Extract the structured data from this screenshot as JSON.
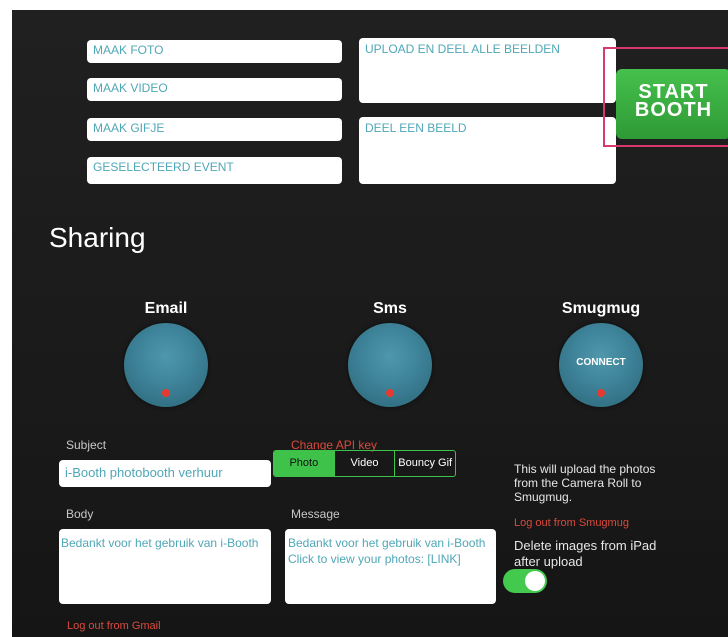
{
  "fields": {
    "maak_foto": "MAAK FOTO",
    "maak_video": "MAAK VIDEO",
    "maak_gifje": "MAAK GIFJE",
    "geselecteerd_event": "GESELECTEERD EVENT",
    "upload_deel": "UPLOAD EN DEEL ALLE BEELDEN",
    "deel_beeld": "DEEL EEN BEELD"
  },
  "start_booth": {
    "line1": "START",
    "line2": "BOOTH"
  },
  "sharing": {
    "heading": "Sharing",
    "services": [
      {
        "label": "Email"
      },
      {
        "label": "Sms"
      },
      {
        "label": "Smugmug",
        "knob_text": "CONNECT"
      }
    ]
  },
  "email": {
    "subject_label": "Subject",
    "subject_value": "i-Booth photobooth verhuur",
    "body_label": "Body",
    "body_value": "Bedankt voor het gebruik van i-Booth",
    "logout": "Log out from Gmail"
  },
  "sms": {
    "change_api": "Change API key",
    "tabs": [
      "Photo",
      "Video",
      "Bouncy Gif"
    ],
    "message_label": "Message",
    "message_line1": "Bedankt voor het gebruik van i-Booth",
    "message_line2": "Click to view your photos: [LINK]"
  },
  "smugmug": {
    "info": "This will upload the photos from the Camera Roll to Smugmug.",
    "logout": "Log out from Smugmug",
    "delete_label": "Delete images from iPad after upload",
    "delete_enabled": true
  },
  "colors": {
    "accent_green": "#3fc24a",
    "link_red": "#d94a3c",
    "knob_teal": "#3d8298"
  }
}
